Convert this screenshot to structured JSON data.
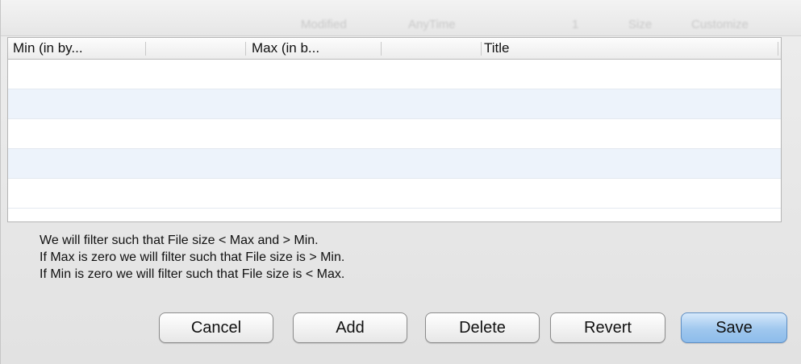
{
  "background_header": {
    "columns": [
      "Modified",
      "AnyTime",
      "1",
      "Size",
      "Customize"
    ]
  },
  "table": {
    "columns": [
      "Min (in by...",
      "Max (in b...",
      "Title"
    ],
    "row_count": 5
  },
  "info_lines": [
    "We will filter such that File size < Max and > Min.",
    "If Max is zero we will filter such that File size is > Min.",
    "If Min is zero we will filter such that File size is < Max."
  ],
  "buttons": {
    "cancel": "Cancel",
    "add": "Add",
    "delete": "Delete",
    "revert": "Revert",
    "save": "Save"
  },
  "colors": {
    "accent": "#9fc7ee",
    "row_alt": "#edf3fb"
  }
}
